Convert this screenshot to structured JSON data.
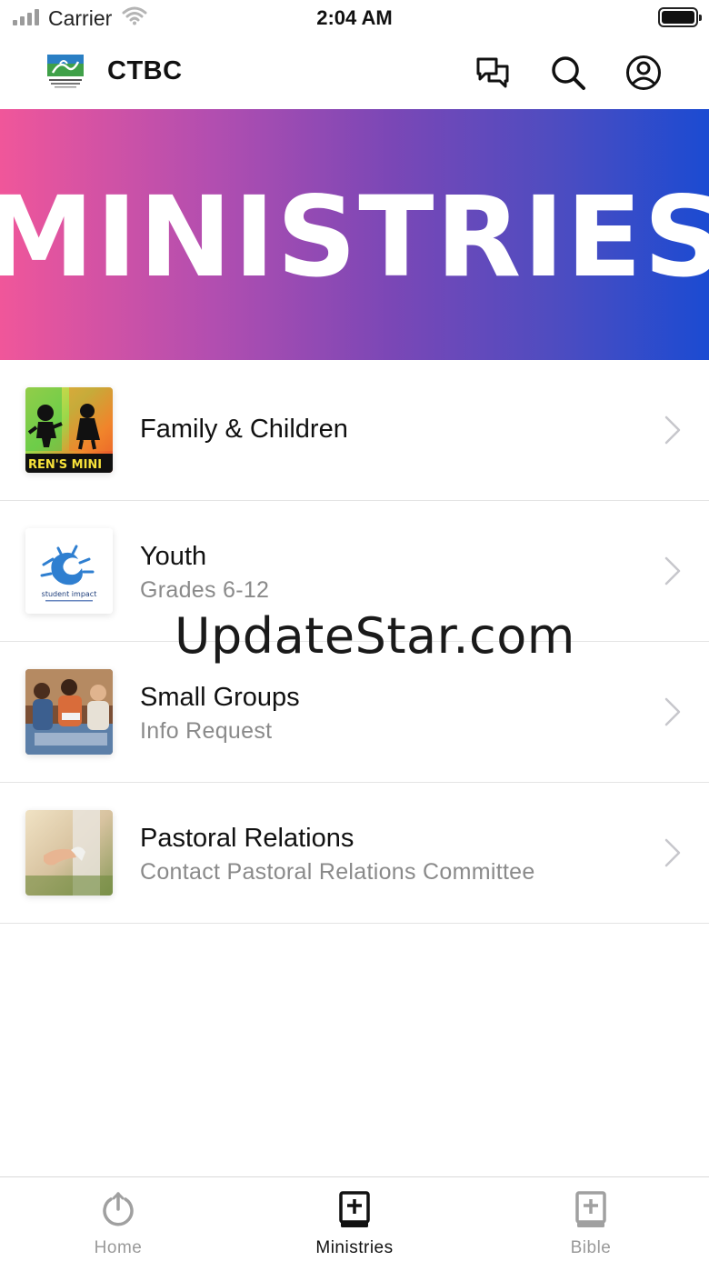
{
  "status_bar": {
    "carrier": "Carrier",
    "time": "2:04 AM",
    "icons": [
      "signal-icon",
      "wifi-icon",
      "battery-icon"
    ]
  },
  "header": {
    "title": "CTBC",
    "logo": "church-logo",
    "actions": [
      {
        "icon": "chat-bubbles-icon"
      },
      {
        "icon": "search-icon"
      },
      {
        "icon": "profile-icon"
      }
    ]
  },
  "banner": {
    "title": "MINISTRIES",
    "gradient_colors": [
      "#f0569a",
      "#7b47b6",
      "#1b4bd2"
    ]
  },
  "ministries": [
    {
      "title": "Family & Children",
      "subtitle": "",
      "thumb_text": "REN'S MINI"
    },
    {
      "title": "Youth",
      "subtitle": "Grades 6-12",
      "thumb_text": "student impact"
    },
    {
      "title": "Small Groups",
      "subtitle": "Info Request"
    },
    {
      "title": "Pastoral Relations",
      "subtitle": "Contact Pastoral Relations Committee"
    }
  ],
  "watermark": "UpdateStar.com",
  "tabs": [
    {
      "label": "Home",
      "icon": "power-icon",
      "active": false
    },
    {
      "label": "Ministries",
      "icon": "bible-plus-icon",
      "active": true
    },
    {
      "label": "Bible",
      "icon": "bible-plus-icon",
      "active": false
    }
  ],
  "colors": {
    "active_tab": "#111111",
    "inactive_tab": "#9a9a9a",
    "subtitle": "#8a8a8a"
  }
}
